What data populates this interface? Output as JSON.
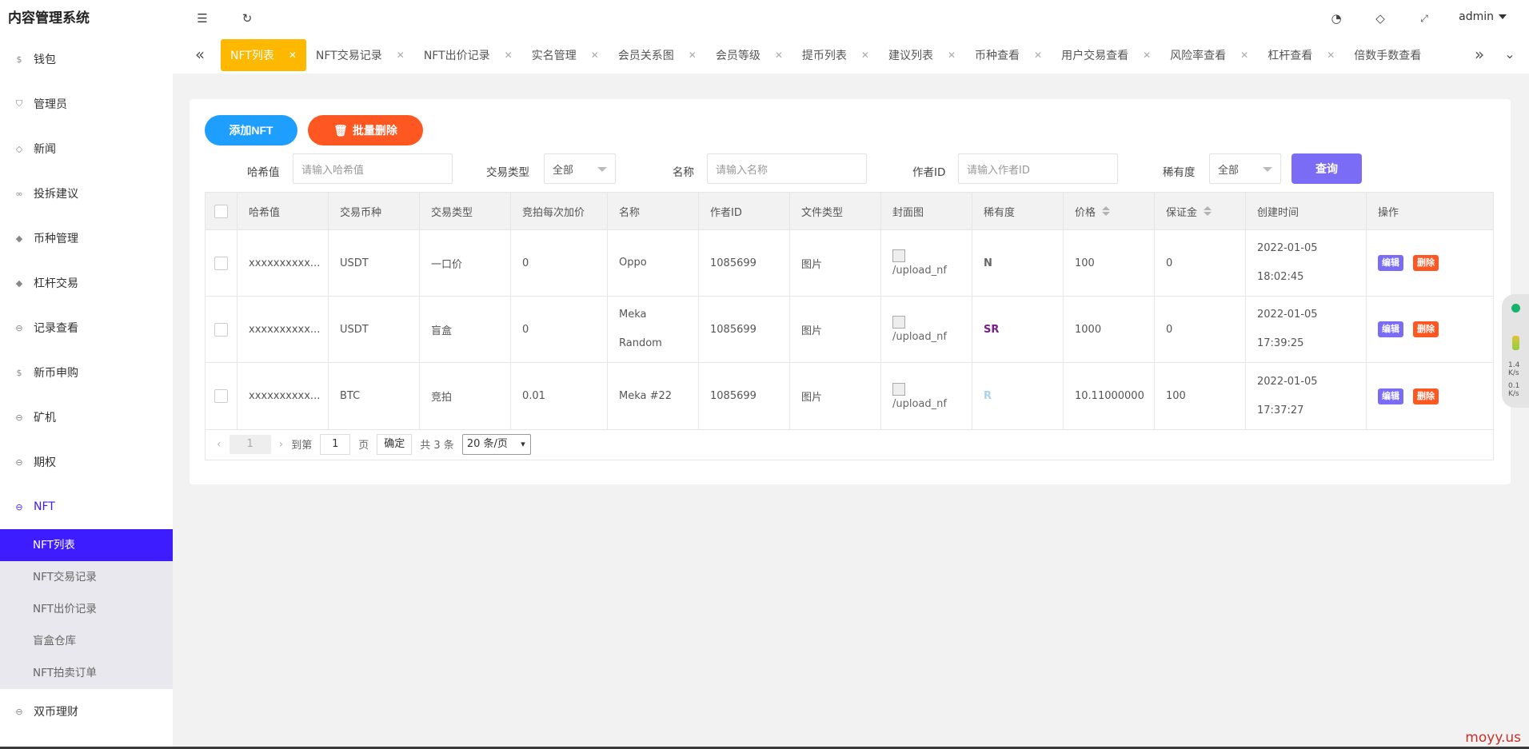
{
  "sidebar": {
    "brand": "内容管理系统",
    "items": [
      {
        "label": "钱包",
        "icon": "dollar-circle-icon"
      },
      {
        "label": "管理员",
        "icon": "shield-icon"
      },
      {
        "label": "新闻",
        "icon": "tag-icon"
      },
      {
        "label": "投拆建议",
        "icon": "link-icon"
      },
      {
        "label": "币种管理",
        "icon": "diamond-icon"
      },
      {
        "label": "杠杆交易",
        "icon": "diamond-icon"
      },
      {
        "label": "记录查看",
        "icon": "circle-arrow-icon"
      },
      {
        "label": "新币申购",
        "icon": "dollar-circle-icon"
      },
      {
        "label": "矿机",
        "icon": "circle-arrow-icon"
      },
      {
        "label": "期权",
        "icon": "circle-arrow-icon"
      },
      {
        "label": "NFT",
        "icon": "circle-arrow-icon"
      }
    ],
    "submenu": [
      "NFT列表",
      "NFT交易记录",
      "NFT出价记录",
      "盲盒仓库",
      "NFT拍卖订单"
    ],
    "after": {
      "label": "双币理财",
      "icon": "circle-arrow-icon"
    }
  },
  "header": {
    "user": "admin"
  },
  "tabs": [
    "NFT列表",
    "NFT交易记录",
    "NFT出价记录",
    "实名管理",
    "会员关系图",
    "会员等级",
    "提币列表",
    "建议列表",
    "币种查看",
    "用户交易查看",
    "风险率查看",
    "杠杆查看",
    "倍数手数查看"
  ],
  "actions": {
    "add": "添加NFT",
    "batch_delete": "批量删除"
  },
  "filters": {
    "hash_label": "哈希值",
    "hash_placeholder": "请输入哈希值",
    "type_label": "交易类型",
    "type_value": "全部",
    "name_label": "名称",
    "name_placeholder": "请输入名称",
    "author_label": "作者ID",
    "author_placeholder": "请输入作者ID",
    "rarity_label": "稀有度",
    "rarity_value": "全部",
    "query": "查询"
  },
  "table": {
    "columns": [
      "哈希值",
      "交易币种",
      "交易类型",
      "竞拍每次加价",
      "名称",
      "作者ID",
      "文件类型",
      "封面图",
      "稀有度",
      "价格",
      "保证金",
      "创建时间",
      "操作"
    ],
    "rows": [
      {
        "hash": "xxxxxxxxxx...",
        "coin": "USDT",
        "type": "一口价",
        "increment": "0",
        "name1": "Oppo",
        "name2": "",
        "author": "1085699",
        "file": "图片",
        "cover": "/upload_nf",
        "rarity": "N",
        "rarity_color": "#666666",
        "price": "100",
        "deposit": "0",
        "date": "2022-01-05",
        "time": "18:02:45"
      },
      {
        "hash": "xxxxxxxxxx...",
        "coin": "USDT",
        "type": "盲盒",
        "increment": "0",
        "name1": "Meka",
        "name2": "Random",
        "author": "1085699",
        "file": "图片",
        "cover": "/upload_nf",
        "rarity": "SR",
        "rarity_color": "#7a1f8a",
        "price": "1000",
        "deposit": "0",
        "date": "2022-01-05",
        "time": "17:39:25"
      },
      {
        "hash": "xxxxxxxxxx...",
        "coin": "BTC",
        "type": "竞拍",
        "increment": "0.01",
        "name1": "Meka #22",
        "name2": "",
        "author": "1085699",
        "file": "图片",
        "cover": "/upload_nf",
        "rarity": "R",
        "rarity_color": "#a9d3ea",
        "price": "10.11000000",
        "deposit": "100",
        "date": "2022-01-05",
        "time": "17:37:27"
      }
    ],
    "edit": "编辑",
    "delete": "删除"
  },
  "pager": {
    "current": "1",
    "goto": "到第",
    "page_input": "1",
    "page_unit": "页",
    "confirm": "确定",
    "total": "共 3 条",
    "size": "20 条/页"
  },
  "widget": {
    "up": "1.4",
    "down": "0.1",
    "unit": "K/s"
  },
  "watermark": "moyy.us"
}
